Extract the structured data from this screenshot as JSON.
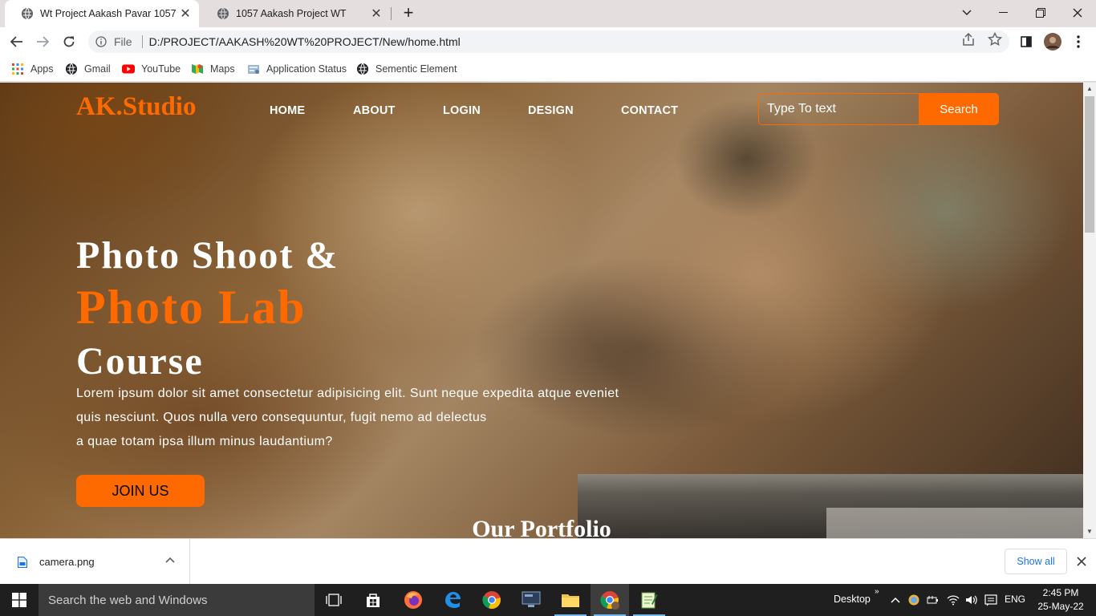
{
  "browser": {
    "tabs": [
      {
        "title": "Wt Project Aakash Pavar 1057",
        "active": true
      },
      {
        "title": "1057 Aakash Project WT",
        "active": false
      }
    ],
    "address": {
      "scheme_label": "File",
      "url": "D:/PROJECT/AAKASH%20WT%20PROJECT/New/home.html"
    },
    "bookmarks": [
      {
        "label": "Apps",
        "icon": "apps-grid-icon"
      },
      {
        "label": "Gmail",
        "icon": "globe-icon"
      },
      {
        "label": "YouTube",
        "icon": "youtube-icon"
      },
      {
        "label": "Maps",
        "icon": "maps-icon"
      },
      {
        "label": "Application Status",
        "icon": "application-status-icon"
      },
      {
        "label": "Sementic Element",
        "icon": "globe-icon"
      }
    ]
  },
  "page": {
    "brand": "AK.Studio",
    "nav": [
      "HOME",
      "ABOUT",
      "LOGIN",
      "DESIGN",
      "CONTACT"
    ],
    "search": {
      "placeholder": "Type To text",
      "button": "Search"
    },
    "hero": {
      "line1": "Photo Shoot &",
      "line2": "Photo Lab",
      "line3": "Course",
      "description": [
        "Lorem ipsum dolor sit amet consectetur adipisicing elit. Sunt neque expedita atque eveniet",
        "quis nesciunt. Quos nulla vero consequuntur, fugit nemo ad delectus",
        "a quae totam ipsa illum minus laudantium?"
      ],
      "cta": "JOIN US"
    },
    "portfolio_heading": "Our Portfolio"
  },
  "downloads": {
    "file": "camera.png",
    "show_all": "Show all"
  },
  "taskbar": {
    "search_placeholder": "Search the web and Windows",
    "desktop_label": "Desktop",
    "language": "ENG",
    "time": "2:45 PM",
    "date": "25-May-22"
  },
  "colors": {
    "accent": "#ff6a00",
    "tab_strip": "#e4dede",
    "taskbar": "#1f1f1f"
  }
}
